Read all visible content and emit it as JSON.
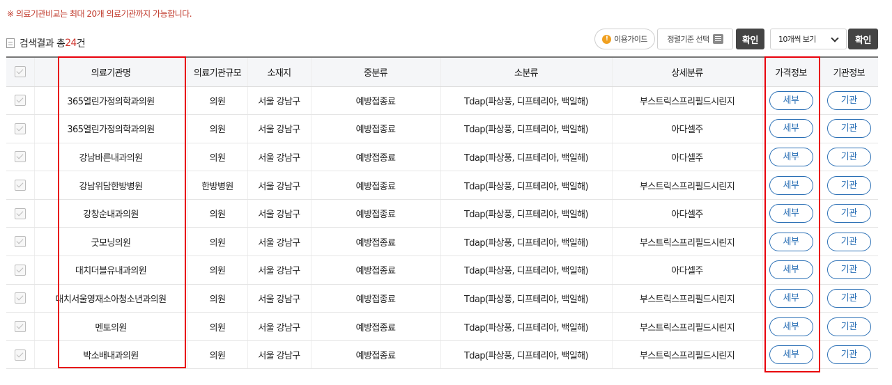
{
  "notice": "※ 의료기관비교는 최대 20개 의료기관까지 가능합니다.",
  "summary": {
    "prefix": "검색결과 총",
    "count": "24",
    "suffix": "건"
  },
  "toolbar": {
    "guide_label": "이용가이드",
    "sort_label": "정렬기준 선택",
    "confirm_label": "확인",
    "page_size_value": "10개씩 보기",
    "confirm2_label": "확인"
  },
  "columns": [
    "",
    "의료기관명",
    "의료기관규모",
    "소재지",
    "중분류",
    "소분류",
    "상세분류",
    "가격정보",
    "기관정보"
  ],
  "rows": [
    {
      "name": "365열린가정의학과의원",
      "size": "의원",
      "location": "서울 강남구",
      "mid": "예방접종료",
      "sub": "Tdap(파상풍, 디프테리아, 백일해)",
      "detail": "부스트릭스프리필드시린지",
      "price_btn": "세부",
      "org_btn": "기관"
    },
    {
      "name": "365열린가정의학과의원",
      "size": "의원",
      "location": "서울 강남구",
      "mid": "예방접종료",
      "sub": "Tdap(파상풍, 디프테리아, 백일해)",
      "detail": "아다셀주",
      "price_btn": "세부",
      "org_btn": "기관"
    },
    {
      "name": "강남바른내과의원",
      "size": "의원",
      "location": "서울 강남구",
      "mid": "예방접종료",
      "sub": "Tdap(파상풍, 디프테리아, 백일해)",
      "detail": "아다셀주",
      "price_btn": "세부",
      "org_btn": "기관"
    },
    {
      "name": "강남위담한방병원",
      "size": "한방병원",
      "location": "서울 강남구",
      "mid": "예방접종료",
      "sub": "Tdap(파상풍, 디프테리아, 백일해)",
      "detail": "부스트릭스프리필드시린지",
      "price_btn": "세부",
      "org_btn": "기관"
    },
    {
      "name": "강창순내과의원",
      "size": "의원",
      "location": "서울 강남구",
      "mid": "예방접종료",
      "sub": "Tdap(파상풍, 디프테리아, 백일해)",
      "detail": "아다셀주",
      "price_btn": "세부",
      "org_btn": "기관"
    },
    {
      "name": "굿모닝의원",
      "size": "의원",
      "location": "서울 강남구",
      "mid": "예방접종료",
      "sub": "Tdap(파상풍, 디프테리아, 백일해)",
      "detail": "부스트릭스프리필드시린지",
      "price_btn": "세부",
      "org_btn": "기관"
    },
    {
      "name": "대치더블유내과의원",
      "size": "의원",
      "location": "서울 강남구",
      "mid": "예방접종료",
      "sub": "Tdap(파상풍, 디프테리아, 백일해)",
      "detail": "아다셀주",
      "price_btn": "세부",
      "org_btn": "기관"
    },
    {
      "name": "대치서울영재소아청소년과의원",
      "size": "의원",
      "location": "서울 강남구",
      "mid": "예방접종료",
      "sub": "Tdap(파상풍, 디프테리아, 백일해)",
      "detail": "부스트릭스프리필드시린지",
      "price_btn": "세부",
      "org_btn": "기관"
    },
    {
      "name": "멘토의원",
      "size": "의원",
      "location": "서울 강남구",
      "mid": "예방접종료",
      "sub": "Tdap(파상풍, 디프테리아, 백일해)",
      "detail": "부스트릭스프리필드시린지",
      "price_btn": "세부",
      "org_btn": "기관"
    },
    {
      "name": "박소배내과의원",
      "size": "의원",
      "location": "서울 강남구",
      "mid": "예방접종료",
      "sub": "Tdap(파상풍, 디프테리아, 백일해)",
      "detail": "부스트릭스프리필드시린지",
      "price_btn": "세부",
      "org_btn": "기관"
    }
  ],
  "colors": {
    "accent": "#2a6fb5",
    "highlight": "#e8000b",
    "notice": "#c0392b",
    "count": "#d0342c"
  }
}
